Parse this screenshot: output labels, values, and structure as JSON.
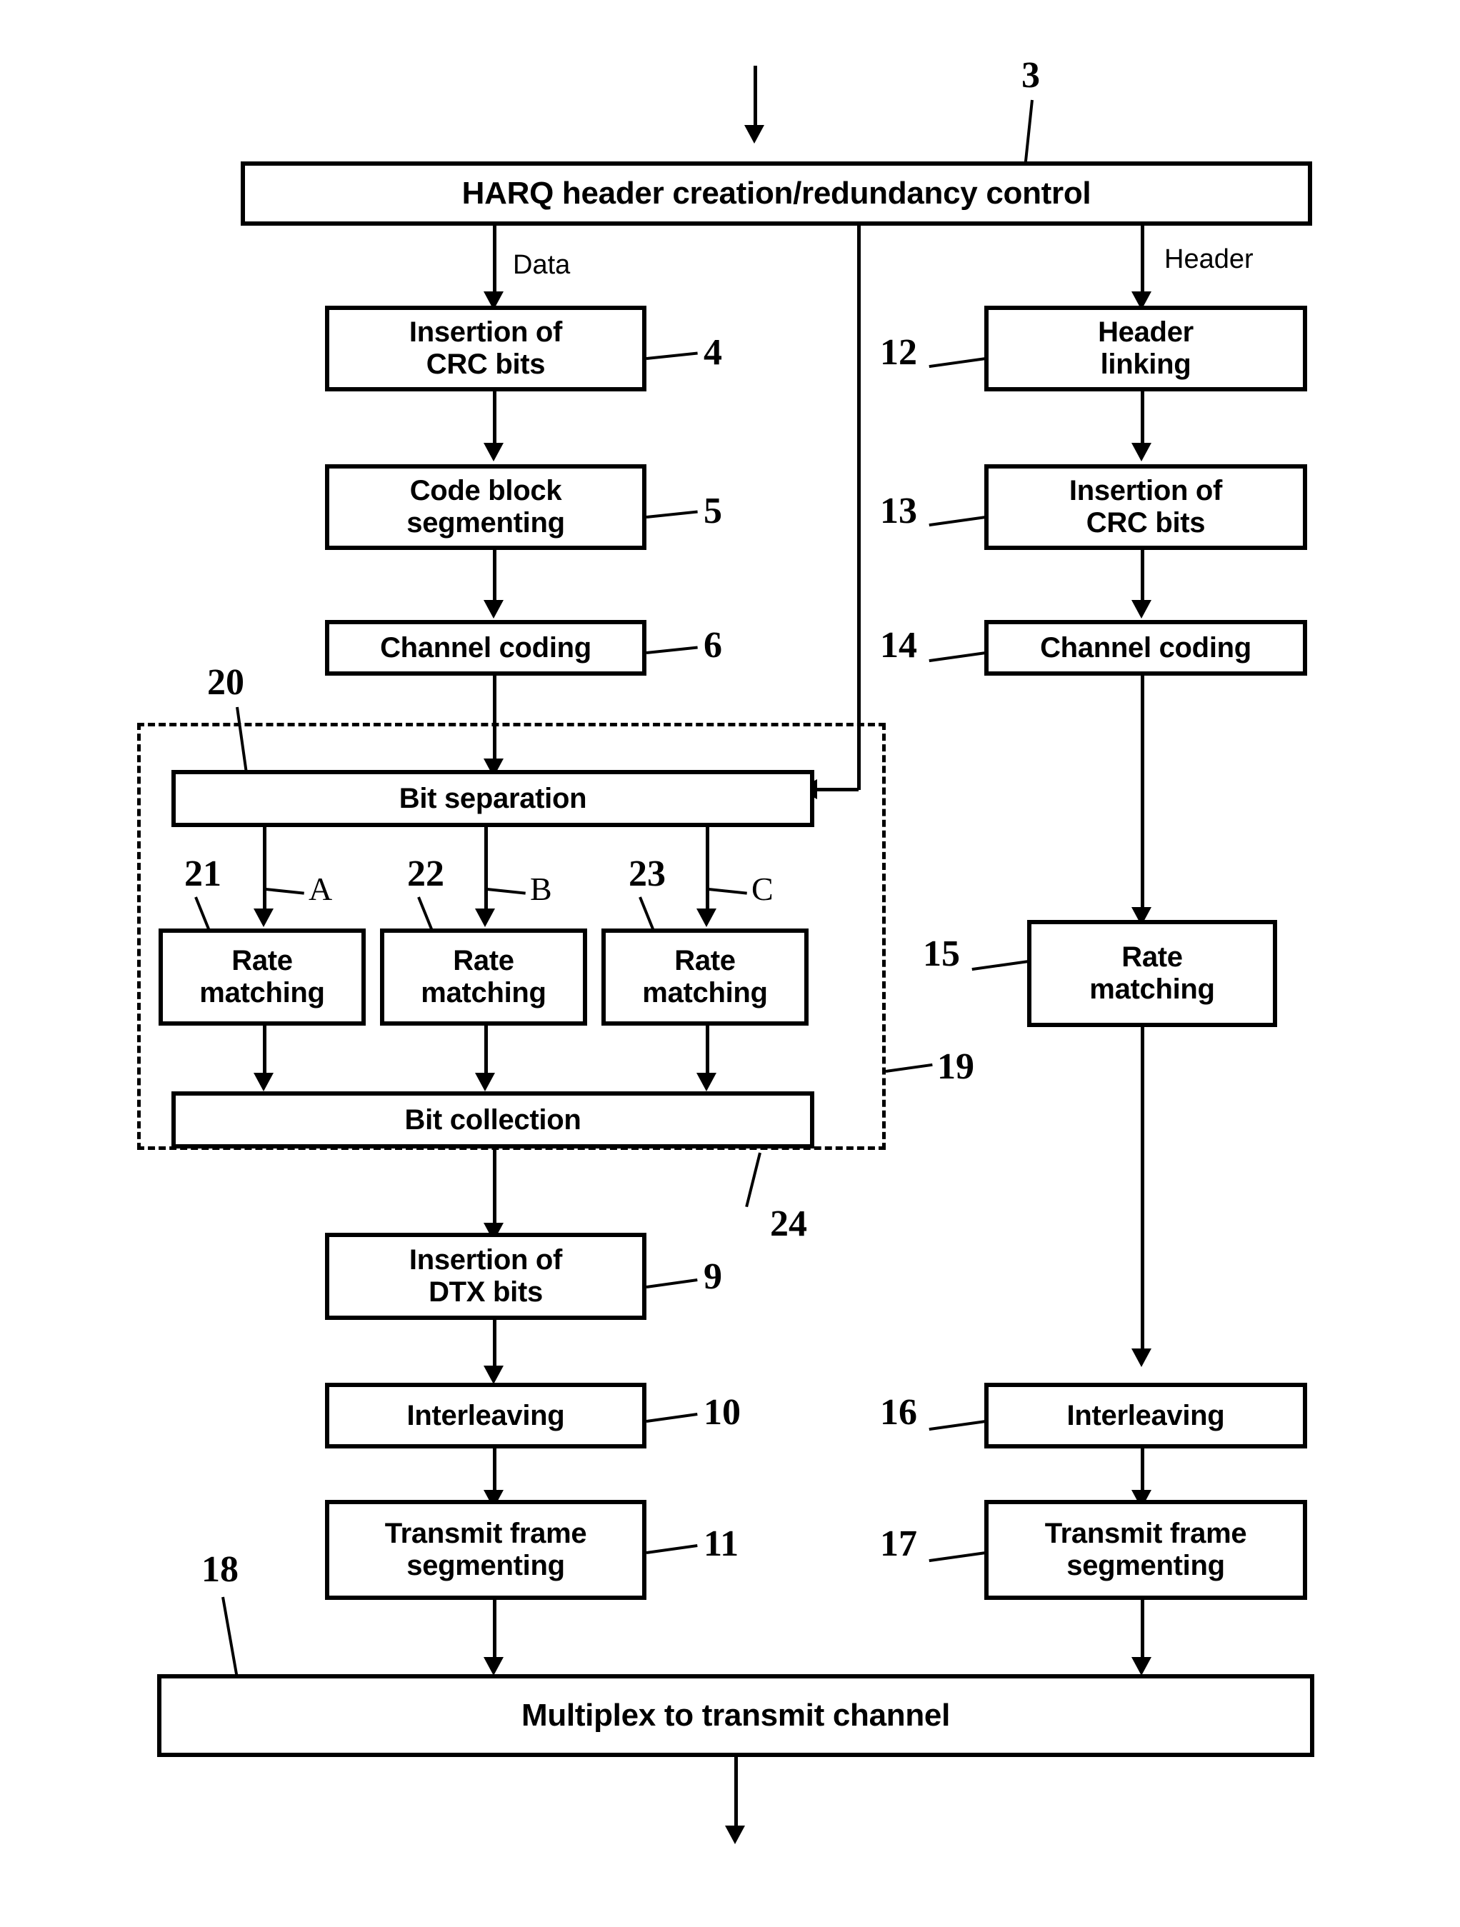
{
  "figure": {
    "type": "patent-block-diagram",
    "description": "HARQ transmit processing chain with separate data and header branches"
  },
  "blocks": {
    "harq": {
      "label": "HARQ header creation/redundancy control",
      "ref": "3"
    },
    "crc_data": {
      "label": "Insertion of\nCRC bits",
      "line1": "Insertion of",
      "line2": "CRC bits",
      "ref": "4"
    },
    "code_block": {
      "label": "Code block\nsegmenting",
      "line1": "Code block",
      "line2": "segmenting",
      "ref": "5"
    },
    "channel_coding_data": {
      "label": "Channel coding",
      "ref": "6"
    },
    "bit_separation": {
      "label": "Bit separation",
      "ref": "20"
    },
    "rate_matching_a": {
      "line1": "Rate",
      "line2": "matching",
      "ref": "21"
    },
    "rate_matching_b": {
      "line1": "Rate",
      "line2": "matching",
      "ref": "22"
    },
    "rate_matching_c": {
      "line1": "Rate",
      "line2": "matching",
      "ref": "23"
    },
    "bit_collection": {
      "label": "Bit collection",
      "ref": "24"
    },
    "dtx": {
      "line1": "Insertion of",
      "line2": "DTX bits",
      "ref": "9"
    },
    "interleaving_data": {
      "label": "Interleaving",
      "ref": "10"
    },
    "tfs_data": {
      "line1": "Transmit frame",
      "line2": "segmenting",
      "ref": "11"
    },
    "header_linking": {
      "line1": "Header",
      "line2": "linking",
      "ref": "12"
    },
    "crc_header": {
      "line1": "Insertion of",
      "line2": "CRC bits",
      "ref": "13"
    },
    "channel_coding_header": {
      "label": "Channel coding",
      "ref": "14"
    },
    "rate_matching_header": {
      "line1": "Rate",
      "line2": "matching",
      "ref": "15"
    },
    "interleaving_header": {
      "label": "Interleaving",
      "ref": "16"
    },
    "tfs_header": {
      "line1": "Transmit frame",
      "line2": "segmenting",
      "ref": "17"
    },
    "multiplex": {
      "label": "Multiplex to transmit channel",
      "ref": "18"
    },
    "enclosure": {
      "ref": "19"
    }
  },
  "signals": {
    "data": "Data",
    "header": "Header",
    "branch_a": "A",
    "branch_b": "B",
    "branch_c": "C"
  },
  "colors": {
    "stroke": "#000000",
    "background": "#ffffff"
  }
}
